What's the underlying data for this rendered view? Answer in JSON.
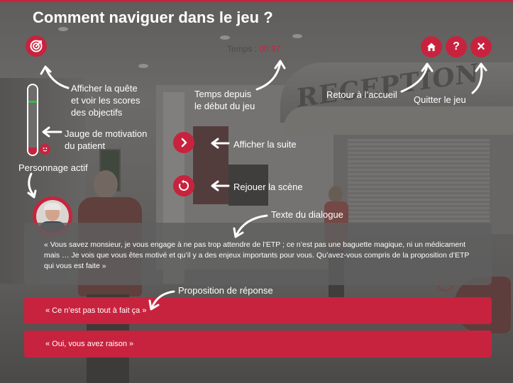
{
  "title": "Comment naviguer dans le jeu ?",
  "timer": {
    "label": "Temps : ",
    "value": "00:37"
  },
  "buttons": {
    "quest": {
      "icon": "target-icon"
    },
    "home": {
      "icon": "home-icon"
    },
    "help": {
      "icon": "question-icon",
      "glyph": "?"
    },
    "quit": {
      "icon": "close-icon",
      "glyph": "×"
    },
    "next": {
      "icon": "chevron-right-icon"
    },
    "replay": {
      "icon": "replay-icon"
    }
  },
  "gauge": {
    "level": 0.1,
    "marker": 0.75,
    "face_icon": "smiley-icon"
  },
  "annotations": {
    "quest": "Afficher la quête\net voir les scores\ndes objectifs",
    "timer": "Temps depuis\nle début du jeu",
    "home": "Retour à l’accueil",
    "quit": "Quitter le jeu",
    "gauge": "Jauge de motivation\ndu patient",
    "character": "Personnage actif",
    "next": "Afficher la suite",
    "replay": "Rejouer la scène",
    "dialog": "Texte du dialogue",
    "response": "Proposition de réponse"
  },
  "dialog": {
    "text": "« Vous savez monsieur, je vous engage à ne pas trop attendre de l’ETP ; ce n’est pas une baguette magique, ni un médicament mais … Je vois que vous êtes motivé et qu’il y a des enjeux importants pour vous. Qu’avez-vous compris de la proposition d’ETP qui vous est faite »"
  },
  "responses": [
    "« Ce n’est pas tout à fait ça »",
    "« Oui, vous avez raison »"
  ],
  "colors": {
    "accent": "#c8233e",
    "marker": "#3fb44a",
    "text": "#ffffff"
  }
}
